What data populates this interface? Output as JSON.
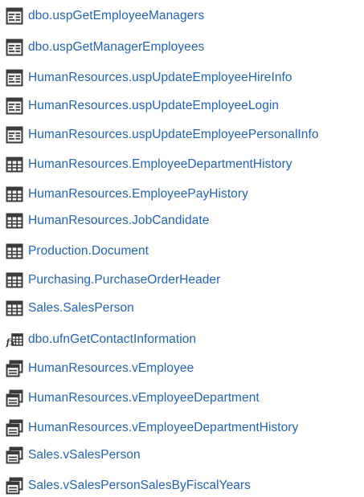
{
  "colors": {
    "link": "#2165b4",
    "icon_dark": "#3a3a3a",
    "icon_light": "#f2f2f2"
  },
  "objects": [
    {
      "label": "dbo.uspGetEmployeeManagers",
      "icon": "stored-procedure-icon"
    },
    {
      "label": "dbo.uspGetManagerEmployees",
      "icon": "stored-procedure-icon"
    },
    {
      "label": "HumanResources.uspUpdateEmployeeHireInfo",
      "icon": "stored-procedure-icon"
    },
    {
      "label": "HumanResources.uspUpdateEmployeeLogin",
      "icon": "stored-procedure-icon"
    },
    {
      "label": "HumanResources.uspUpdateEmployeePersonalInfo",
      "icon": "stored-procedure-icon"
    },
    {
      "label": "HumanResources.EmployeeDepartmentHistory",
      "icon": "table-icon"
    },
    {
      "label": "HumanResources.EmployeePayHistory",
      "icon": "table-icon"
    },
    {
      "label": "HumanResources.JobCandidate",
      "icon": "table-icon"
    },
    {
      "label": "Production.Document",
      "icon": "table-icon"
    },
    {
      "label": "Purchasing.PurchaseOrderHeader",
      "icon": "table-icon"
    },
    {
      "label": "Sales.SalesPerson",
      "icon": "table-icon"
    },
    {
      "label": "dbo.ufnGetContactInformation",
      "icon": "table-function-icon"
    },
    {
      "label": "HumanResources.vEmployee",
      "icon": "view-icon"
    },
    {
      "label": "HumanResources.vEmployeeDepartment",
      "icon": "view-icon"
    },
    {
      "label": "HumanResources.vEmployeeDepartmentHistory",
      "icon": "view-icon"
    },
    {
      "label": "Sales.vSalesPerson",
      "icon": "view-icon"
    },
    {
      "label": "Sales.vSalesPersonSalesByFiscalYears",
      "icon": "view-icon"
    }
  ]
}
